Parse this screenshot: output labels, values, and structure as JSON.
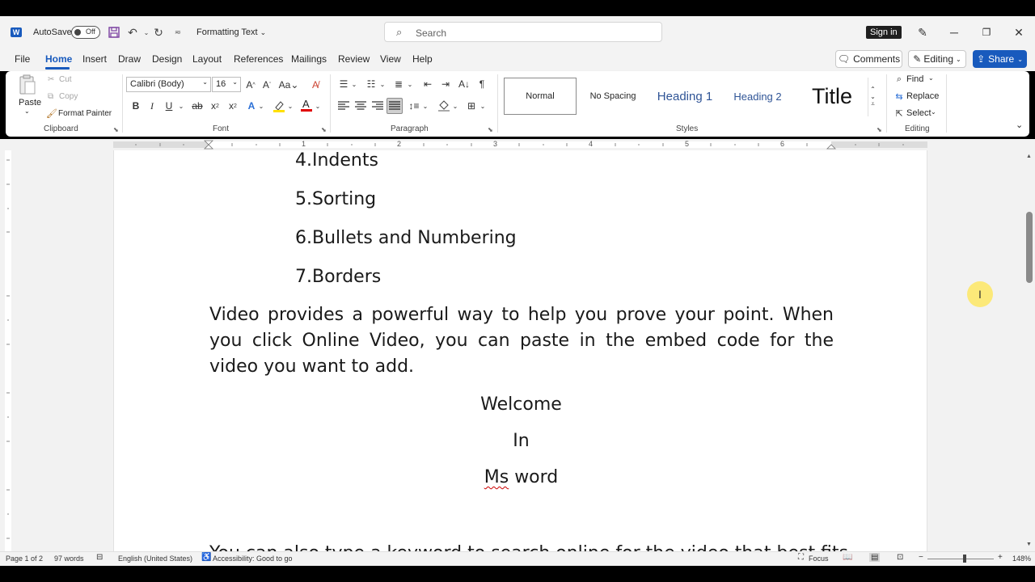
{
  "titlebar": {
    "app_logo": "W",
    "autosave_label": "AutoSave",
    "autosave_state": "Off",
    "doc_title": "Formatting Text",
    "search_placeholder": "Search",
    "signin_label": "Sign in"
  },
  "menu": {
    "tabs": [
      "File",
      "Home",
      "Insert",
      "Draw",
      "Design",
      "Layout",
      "References",
      "Mailings",
      "Review",
      "View",
      "Help"
    ],
    "comments_label": "Comments",
    "editing_label": "Editing",
    "share_label": "Share"
  },
  "ribbon": {
    "clipboard": {
      "paste": "Paste",
      "cut": "Cut",
      "copy": "Copy",
      "format_painter": "Format Painter",
      "label": "Clipboard"
    },
    "font": {
      "font_name": "Calibri (Body)",
      "font_size": "16",
      "label": "Font"
    },
    "paragraph": {
      "label": "Paragraph"
    },
    "styles": {
      "items": [
        "Normal",
        "No Spacing",
        "Heading 1",
        "Heading 2",
        "Title"
      ],
      "label": "Styles"
    },
    "editing": {
      "find": "Find",
      "replace": "Replace",
      "select": "Select",
      "label": "Editing"
    }
  },
  "ruler": {
    "numbers": [
      "1",
      "2",
      "3",
      "4",
      "5",
      "6"
    ]
  },
  "document": {
    "list_items": [
      "4.Indents",
      "5.Sorting",
      "6.Bullets and Numbering",
      "7.Borders"
    ],
    "paragraph": "Video provides a powerful way to help you prove your point. When you click Online Video, you can paste in the embed code for the video you want to add.",
    "centered": [
      "Welcome",
      "In"
    ],
    "ms_word_ms": "Ms",
    "ms_word_word": "word",
    "cutoff_line": "You can also type a keyword to search online for the video that best fits"
  },
  "status": {
    "page": "Page 1 of 2",
    "words": "97 words",
    "language": "English (United States)",
    "accessibility": "Accessibility: Good to go",
    "focus": "Focus",
    "zoom": "148%"
  }
}
